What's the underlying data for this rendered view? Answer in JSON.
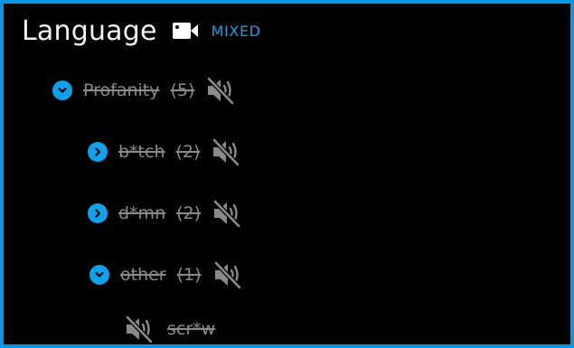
{
  "header": {
    "title": "Language",
    "mode": "MIXED",
    "camera_icon": "video-camera-icon"
  },
  "colors": {
    "accent": "#0ea2ea",
    "muted_text": "#8a8a8a",
    "title_text": "#f2f2f2",
    "background": "#000000"
  },
  "tree": {
    "profanity": {
      "label": "Profanity",
      "count": "(5)",
      "expanded": true,
      "muted": true
    },
    "bitch": {
      "label": "b*tch",
      "count": "(2)",
      "expanded": false,
      "muted": true
    },
    "damn": {
      "label": "d*mn",
      "count": "(2)",
      "expanded": false,
      "muted": true
    },
    "other": {
      "label": "other",
      "count": "(1)",
      "expanded": true,
      "muted": true
    },
    "screw": {
      "label": "scr*w",
      "muted": true
    }
  },
  "icons": {
    "expand_open": "chevron-down-icon",
    "expand_closed": "chevron-right-icon",
    "mute": "speaker-muted-icon"
  }
}
